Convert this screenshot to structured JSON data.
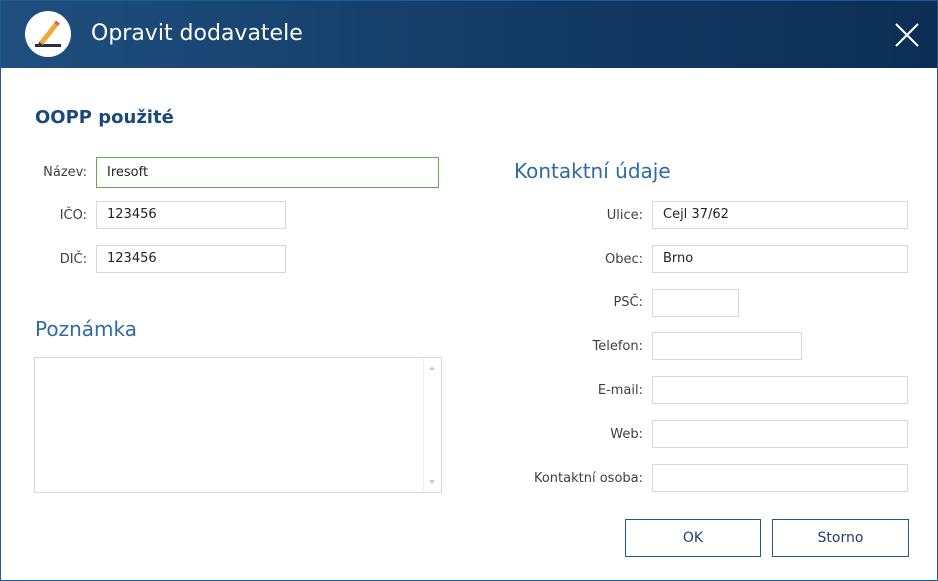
{
  "window": {
    "title": "Opravit dodavatele"
  },
  "form": {
    "section_title": "OOPP použité",
    "nazev_label": "Název:",
    "nazev_value": "Iresoft",
    "ico_label": "IČO:",
    "ico_value": "123456",
    "dic_label": "DIČ:",
    "dic_value": "123456",
    "poznamka_heading": "Poznámka",
    "poznamka_value": ""
  },
  "contact": {
    "heading": "Kontaktní údaje",
    "ulice_label": "Ulice:",
    "ulice_value": "Cejl 37/62",
    "obec_label": "Obec:",
    "obec_value": "Brno",
    "psc_label": "PSČ:",
    "psc_value": "",
    "telefon_label": "Telefon:",
    "telefon_value": "",
    "email_label": "E-mail:",
    "email_value": "",
    "web_label": "Web:",
    "web_value": "",
    "kontaktni_osoba_label": "Kontaktní osoba:",
    "kontaktni_osoba_value": ""
  },
  "buttons": {
    "ok_label": "OK",
    "cancel_label": "Storno"
  },
  "icons": {
    "app": "pencil-icon",
    "close": "close-icon"
  },
  "colors": {
    "titlebar": "#153e69",
    "accent": "#1a4a7a",
    "focus_border": "#6aa84f"
  }
}
